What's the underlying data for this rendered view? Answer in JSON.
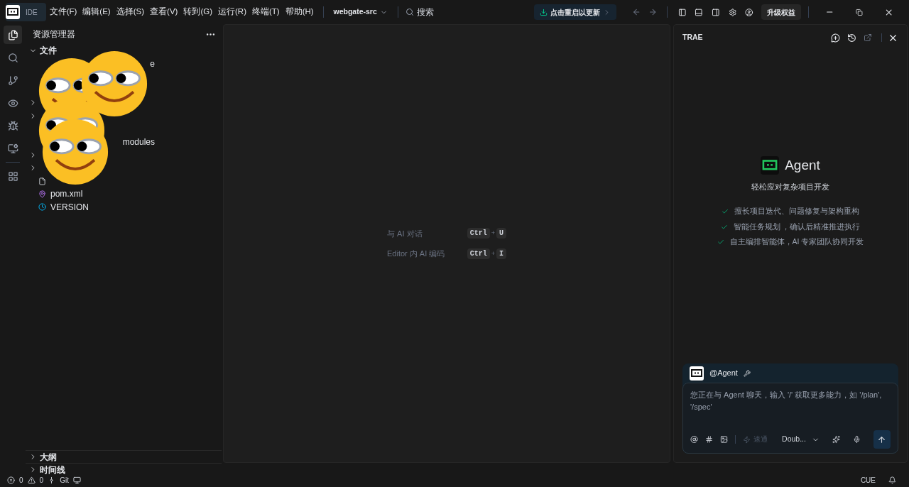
{
  "titlebar": {
    "badge": "IDE",
    "menus": [
      "文件(F)",
      "编辑(E)",
      "选择(S)",
      "查看(V)",
      "转到(G)",
      "运行(R)",
      "终端(T)",
      "帮助(H)"
    ],
    "project": "webgate-src",
    "search": "搜索",
    "update": "点击重启以更新",
    "upgrade": "升级权益"
  },
  "activity": [
    {
      "selected": true
    },
    {
      "selected": false
    },
    {
      "selected": false
    },
    {
      "selected": false
    },
    {
      "selected": false
    },
    {
      "selected": false
    },
    {
      "selected": false
    }
  ],
  "explorer": {
    "title": "资源管理器",
    "rows": [
      {
        "kind": "folder",
        "label": "文件",
        "expanded": true
      },
      {
        "kind": "tail",
        "label": "e"
      },
      {
        "kind": "folder",
        "expanded": false
      },
      {
        "kind": "folder",
        "expanded": false
      },
      {
        "kind": "tail",
        "label": "modules"
      },
      {
        "kind": "folder",
        "expanded": false
      },
      {
        "kind": "folder",
        "expanded": false
      },
      {
        "kind": "plain"
      },
      {
        "kind": "maven",
        "label": "pom.xml"
      },
      {
        "kind": "version",
        "label": "VERSION"
      }
    ],
    "sections": [
      {
        "label": "大纲",
        "expanded": false
      },
      {
        "label": "时间线",
        "expanded": false
      }
    ]
  },
  "editor": {
    "shortcuts": [
      {
        "label": "与 AI 对话",
        "keys": [
          "Ctrl",
          "U"
        ],
        "joiner": "+"
      },
      {
        "label": "Editor 内 AI 编码",
        "keys": [
          "Ctrl",
          "I"
        ],
        "joiner": "+"
      }
    ]
  },
  "panel": {
    "title": "TRAE",
    "agent": "Agent",
    "subtitle": "轻松应对复杂项目开发",
    "features": [
      "擅长项目迭代、问题修复与架构重构",
      "智能任务规划 ，确认后精准推进执行",
      "自主编排智能体，AI 专家团队协同开发"
    ],
    "mention": "@Agent",
    "placeholder": "您正在与 Agent 聊天，输入 '/' 获取更多能力，如 '/plan', '/spec'",
    "fast": "速通",
    "model": "Doub..."
  },
  "status": {
    "errors": "0",
    "warnings": "0",
    "git": "Git",
    "cue": "CUE"
  }
}
